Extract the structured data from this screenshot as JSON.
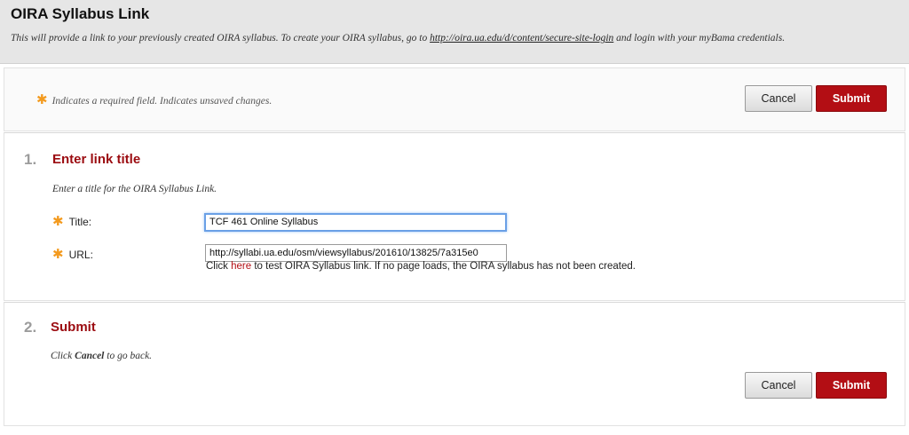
{
  "header": {
    "title": "OIRA Syllabus Link",
    "desc_before": "This will provide a link to your previously created OIRA syllabus. To create your OIRA syllabus, go to ",
    "desc_link": "http://oira.ua.edu/d/content/secure-site-login",
    "desc_after": " and login with your myBama credentials."
  },
  "top": {
    "required_note": "Indicates a required field. Indicates unsaved changes.",
    "cancel_label": "Cancel",
    "submit_label": "Submit"
  },
  "step1": {
    "number": "1.",
    "title": "Enter link title",
    "instruction": "Enter a title for the OIRA Syllabus Link.",
    "title_label": "Title:",
    "title_value": "TCF 461 Online Syllabus",
    "url_label": "URL:",
    "url_value": "http://syllabi.ua.edu/osm/viewsyllabus/201610/13825/7a315e0",
    "help_before": "Click ",
    "help_link": "here",
    "help_after": " to test OIRA Syllabus link. If no page loads, the OIRA syllabus has not been created."
  },
  "step2": {
    "number": "2.",
    "title": "Submit",
    "instr_before": "Click ",
    "instr_bold": "Cancel",
    "instr_after": " to go back.",
    "cancel_label": "Cancel",
    "submit_label": "Submit"
  },
  "icons": {
    "required": "asterisk-icon"
  },
  "colors": {
    "accent": "#b30e14",
    "required_star": "#f39a1e",
    "step_number": "#9c9c9c"
  }
}
